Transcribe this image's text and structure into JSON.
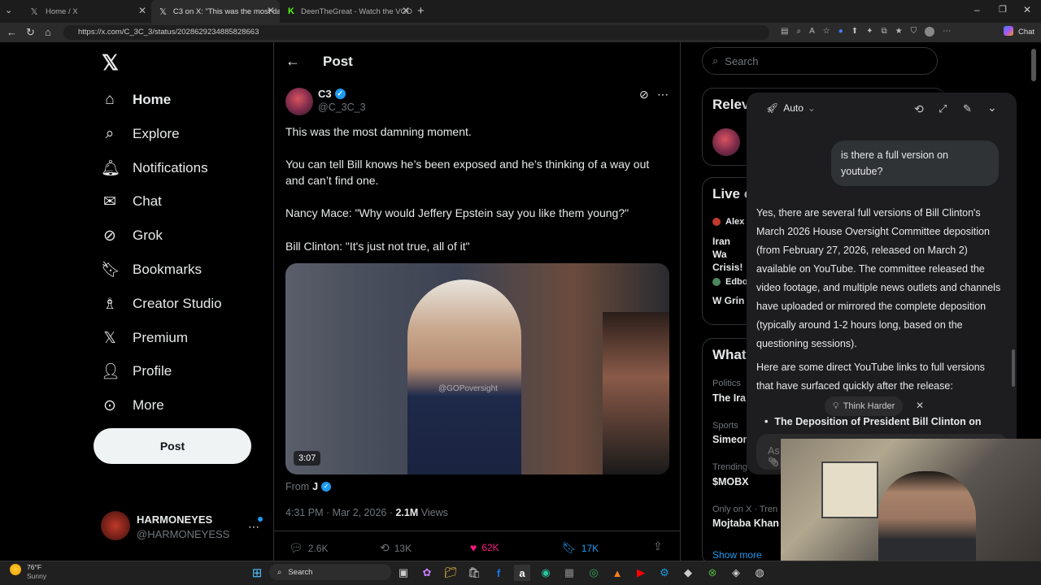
{
  "browser": {
    "tabs": [
      {
        "title": "Home / X"
      },
      {
        "title": "C3 on X: \"This was the most damni"
      },
      {
        "title": "DeenTheGreat - Watch the VOD o"
      }
    ],
    "url": "https://x.com/C_3C_3/status/2028629234885828663",
    "chat_label": "Chat"
  },
  "sidebar": {
    "items": [
      {
        "label": "Home"
      },
      {
        "label": "Explore"
      },
      {
        "label": "Notifications"
      },
      {
        "label": "Chat"
      },
      {
        "label": "Grok"
      },
      {
        "label": "Bookmarks"
      },
      {
        "label": "Creator Studio"
      },
      {
        "label": "Premium"
      },
      {
        "label": "Profile"
      },
      {
        "label": "More"
      }
    ],
    "post_button": "Post",
    "account_name": "HARMONEYES",
    "account_handle": "@HARMONEYESS"
  },
  "post": {
    "header": "Post",
    "author_name": "C3",
    "author_handle": "@C_3C_3",
    "lines": [
      "This was the most damning moment.",
      "You can tell Bill knows he’s been exposed and he’s thinking of a way out and can’t find one.",
      "Nancy Mace: \"Why would Jeffery Epstein say you like them young?\"",
      "Bill Clinton: \"It's just not true, all of it\""
    ],
    "video_duration": "3:07",
    "video_watermark": "@GOPoversight",
    "from_label": "From",
    "from_name": "J",
    "timestamp": "4:31 PM · Mar 2, 2026 · ",
    "views_count": "2.1M",
    "views_label": " Views",
    "replies": "2.6K",
    "reposts": "13K",
    "likes": "62K",
    "bookmarks": "17K"
  },
  "right": {
    "search_placeholder": "Search",
    "relevant_heading": "Relev",
    "live_heading": "Live o",
    "live_item1_user": "Alex",
    "live_item1_title": "Iran Wa Crisis!",
    "live_item2_user": "Edbo",
    "live_item2_title": "W Grin",
    "whats_heading": "What",
    "trends": [
      {
        "category": "Politics",
        "title": "The Ira"
      },
      {
        "category": "Sports",
        "title": "Simeon"
      },
      {
        "category": "Trending",
        "title": "$MOBX"
      },
      {
        "category": "Only on X · Trending",
        "title": "Mojtaba Khan"
      }
    ],
    "show_more": "Show more"
  },
  "grok": {
    "mode": "Auto",
    "user_message": "is there a full version on youtube?",
    "reply_p1": "Yes, there are several full versions of Bill Clinton's March 2026 House Oversight Committee deposition (from February 27, 2026, released on March 2) available on YouTube. The committee released the video footage, and multiple news outlets and channels have uploaded or mirrored the complete deposition (typically around 1-2 hours long, based on the questioning sessions).",
    "reply_p2": "Here are some direct YouTube links to full versions that have surfaced quickly after the release:",
    "bullet1": "The Deposition of President Bill Clinton on",
    "think_harder": "Think Harder",
    "input_placeholder": "As"
  },
  "taskbar": {
    "temp": "76°F",
    "weather": "Sunny",
    "search_label": "Search"
  },
  "colors": {
    "accent": "#1d9bf0",
    "like": "#f91880",
    "background": "#000000"
  }
}
